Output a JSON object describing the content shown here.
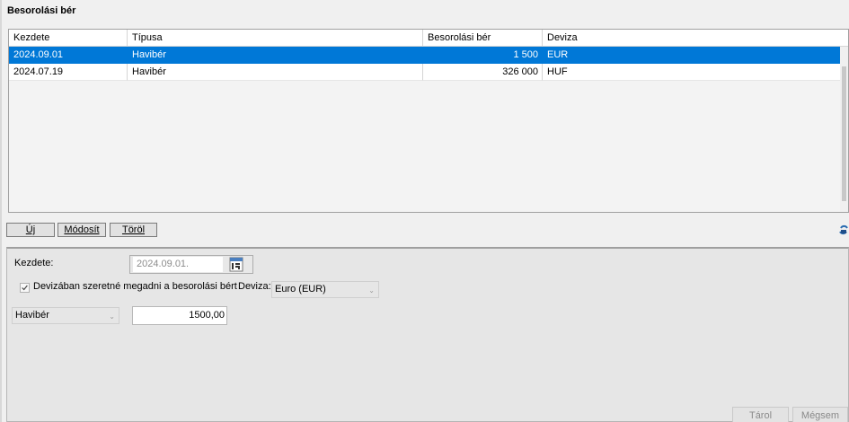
{
  "page": {
    "title": "Besorolási bér"
  },
  "grid": {
    "columns": [
      "Kezdete",
      "Típusa",
      "Besorolási bér",
      "Deviza"
    ],
    "rows": [
      {
        "start": "2024.09.01",
        "type": "Havibér",
        "amount": "1 500",
        "currency": "EUR",
        "selected": true
      },
      {
        "start": "2024.07.19",
        "type": "Havibér",
        "amount": "326 000",
        "currency": "HUF",
        "selected": false
      }
    ]
  },
  "buttons": {
    "new": "Új",
    "modify": "Módosít",
    "delete": "Töröl"
  },
  "form": {
    "start_label": "Kezdete:",
    "start_value": "2024.09.01.",
    "currency_checkbox_label": "Devizában szeretné megadni a besorolási bért",
    "currency_label": "Deviza:",
    "currency_value": "Euro (EUR)",
    "pay_type_value": "Havibér",
    "amount_value": "1500,00",
    "save": "Tárol",
    "cancel": "Mégsem"
  },
  "colors": {
    "selection": "#0078d7",
    "panel": "#e6e6e6"
  },
  "icons": [
    "calendar-icon",
    "refresh-icon",
    "checkmark-icon",
    "chevron-down-icon"
  ]
}
